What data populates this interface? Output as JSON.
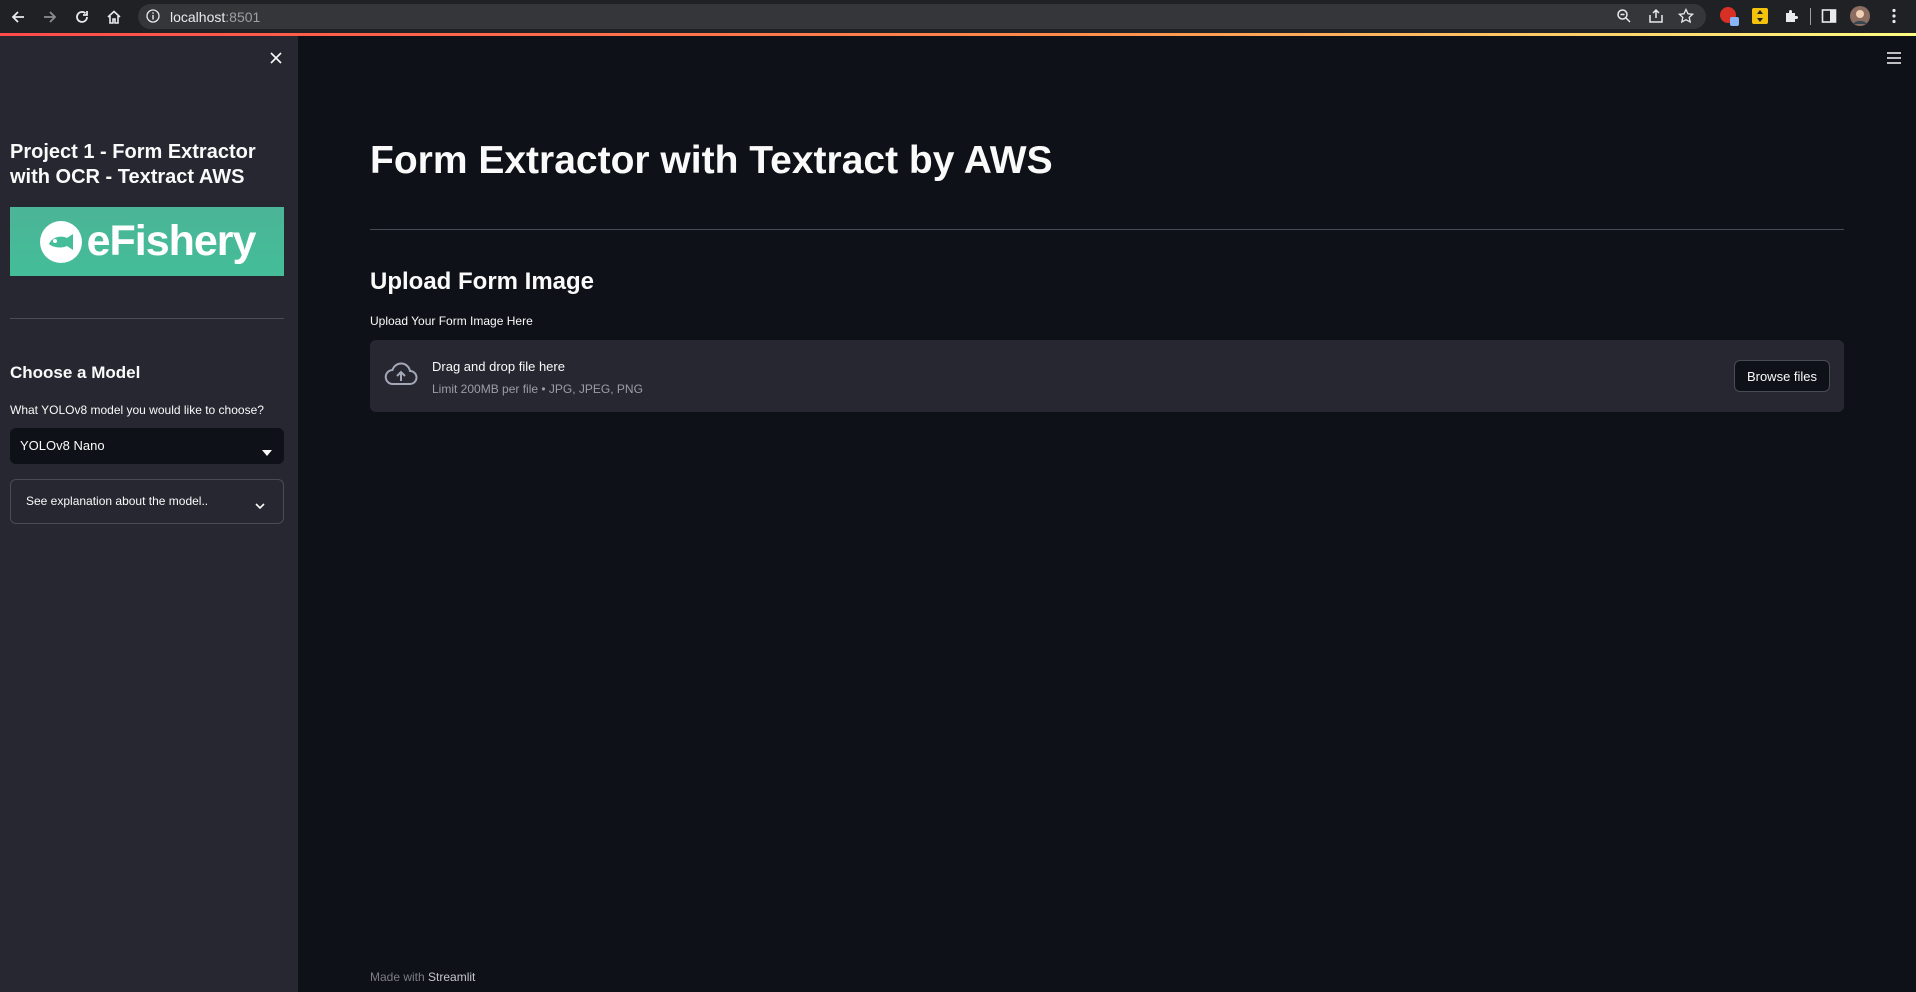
{
  "browser": {
    "url_host": "localhost",
    "url_port": ":8501"
  },
  "sidebar": {
    "title": "Project 1 - Form Extractor with OCR - Textract AWS",
    "logo_text": "eFishery",
    "model_heading": "Choose a Model",
    "model_question": "What YOLOv8 model you would like to choose?",
    "model_selected": "YOLOv8 Nano",
    "expander_label": "See explanation about the model.."
  },
  "main": {
    "title": "Form Extractor with Textract by AWS",
    "section_title": "Upload Form Image",
    "upload_label": "Upload Your Form Image Here",
    "dropzone_title": "Drag and drop file here",
    "dropzone_limits": "Limit 200MB per file • JPG, JPEG, PNG",
    "browse_button": "Browse files"
  },
  "footer": {
    "prefix": "Made with ",
    "brand": "Streamlit"
  },
  "colors": {
    "background": "#0e1117",
    "sidebar": "#262730",
    "text": "#fafafa",
    "logo_green": "#44bd98",
    "accent_red": "#ff4b4b"
  },
  "icons": [
    "back-arrow-icon",
    "forward-arrow-icon",
    "reload-icon",
    "home-icon",
    "info-icon",
    "zoom-icon",
    "share-icon",
    "star-icon",
    "extension-icon",
    "puzzle-icon",
    "side-panel-icon",
    "profile-avatar",
    "kebab-menu-icon",
    "close-icon",
    "caret-down-icon",
    "chevron-down-icon",
    "upload-cloud-icon",
    "hamburger-menu-icon"
  ]
}
